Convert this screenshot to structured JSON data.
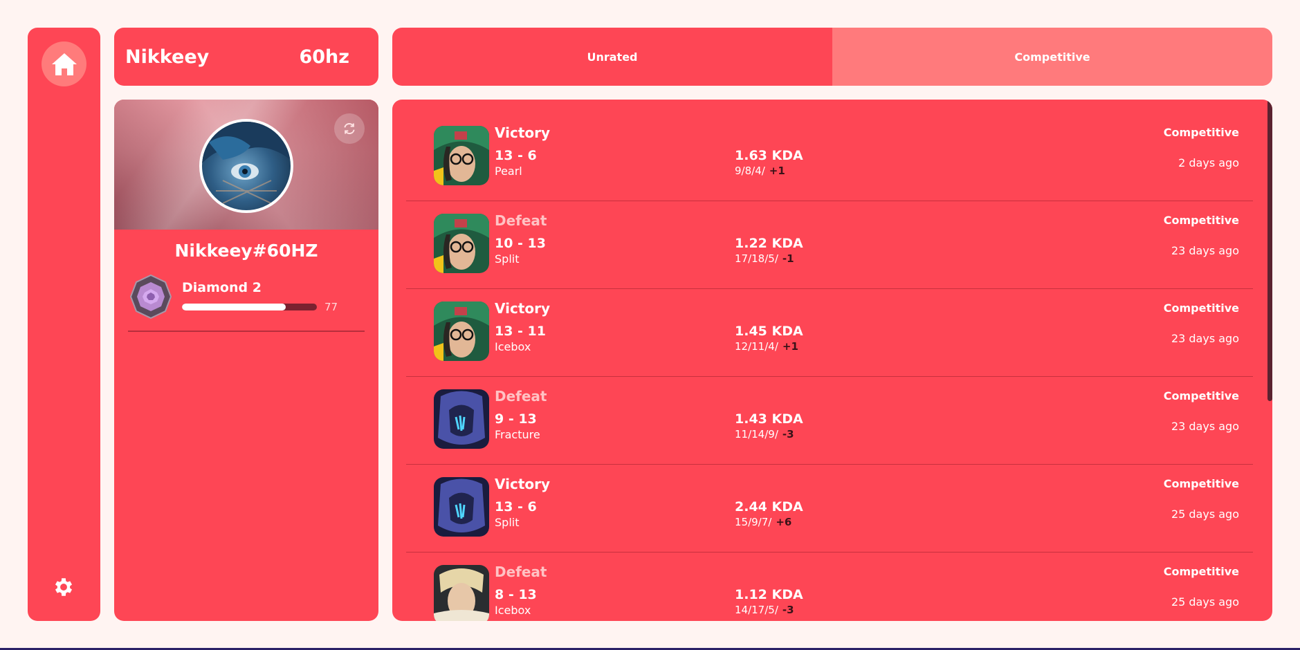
{
  "header": {
    "username": "Nikkeey",
    "tag": "60hz"
  },
  "tabs": [
    {
      "label": "Unrated",
      "active": true
    },
    {
      "label": "Competitive",
      "active": false
    }
  ],
  "profile": {
    "riot_id": "Nikkeey#60HZ",
    "rank": "Diamond 2",
    "rr": "77",
    "rr_fraction": 0.77
  },
  "icons": {
    "home": "home-icon",
    "settings": "gear-icon",
    "refresh": "refresh-icon"
  },
  "colors": {
    "accent": "#fe4655",
    "accent_light": "#ff7a7c",
    "background": "#fff4f2"
  },
  "matches": [
    {
      "result": "Victory",
      "score": "13 - 6",
      "map": "Pearl",
      "kda": "1.63 KDA",
      "kda_line": "9/8/4/",
      "rr_change": "+1",
      "mode": "Competitive",
      "ago": "2 days ago",
      "agent": "killjoy"
    },
    {
      "result": "Defeat",
      "score": "10 - 13",
      "map": "Split",
      "kda": "1.22 KDA",
      "kda_line": "17/18/5/",
      "rr_change": "-1",
      "mode": "Competitive",
      "ago": "23 days ago",
      "agent": "killjoy"
    },
    {
      "result": "Victory",
      "score": "13 - 11",
      "map": "Icebox",
      "kda": "1.45 KDA",
      "kda_line": "12/11/4/",
      "rr_change": "+1",
      "mode": "Competitive",
      "ago": "23 days ago",
      "agent": "killjoy"
    },
    {
      "result": "Defeat",
      "score": "9 - 13",
      "map": "Fracture",
      "kda": "1.43 KDA",
      "kda_line": "11/14/9/",
      "rr_change": "-3",
      "mode": "Competitive",
      "ago": "23 days ago",
      "agent": "omen"
    },
    {
      "result": "Victory",
      "score": "13 - 6",
      "map": "Split",
      "kda": "2.44 KDA",
      "kda_line": "15/9/7/",
      "rr_change": "+6",
      "mode": "Competitive",
      "ago": "25 days ago",
      "agent": "omen"
    },
    {
      "result": "Defeat",
      "score": "8 - 13",
      "map": "Icebox",
      "kda": "1.12 KDA",
      "kda_line": "14/17/5/",
      "rr_change": "-3",
      "mode": "Competitive",
      "ago": "25 days ago",
      "agent": "chamber"
    }
  ]
}
